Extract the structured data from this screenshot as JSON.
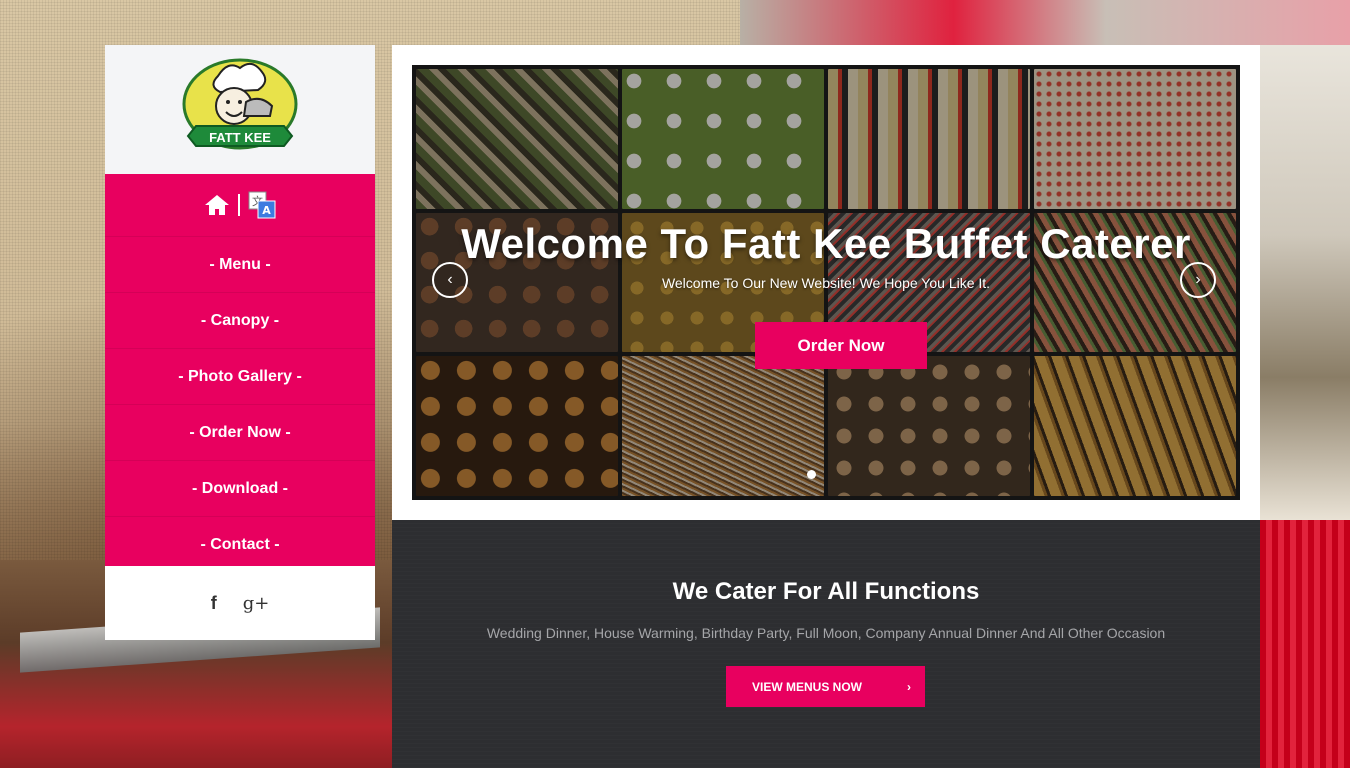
{
  "brand": {
    "logo_text": "FATT KEE"
  },
  "nav": {
    "icons": [
      "home-icon",
      "translate-icon"
    ],
    "items": [
      {
        "label": "- Menu -"
      },
      {
        "label": "- Canopy -"
      },
      {
        "label": "- Photo Gallery -"
      },
      {
        "label": "- Order Now -"
      },
      {
        "label": "- Download -"
      },
      {
        "label": "- Contact -"
      }
    ]
  },
  "social": {
    "facebook": "f",
    "googleplus": "g+"
  },
  "hero": {
    "title": "Welcome To Fatt Kee Buffet Caterer",
    "subtitle": "Welcome To Our New Website! We Hope You Like It.",
    "button": "Order Now",
    "prev_icon": "‹",
    "next_icon": "›"
  },
  "functions": {
    "title": "We Cater For All Functions",
    "subtitle": "Wedding Dinner, House Warming, Birthday Party, Full Moon, Company Annual Dinner And All Other Occasion",
    "cta_label": "VIEW MENUS NOW",
    "cta_icon": "›"
  },
  "colors": {
    "accent": "#e8005f",
    "dark_panel": "#2d2e31"
  }
}
